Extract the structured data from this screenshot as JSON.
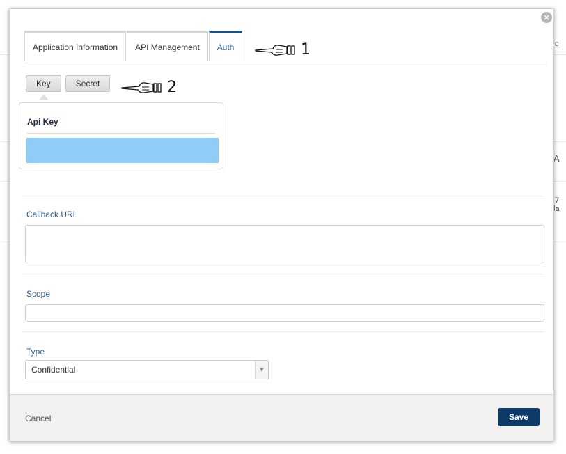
{
  "modal": {
    "close_icon": "close-icon",
    "tabs": [
      {
        "label": "Application Information",
        "active": false
      },
      {
        "label": "API Management",
        "active": false
      },
      {
        "label": "Auth",
        "active": true
      }
    ],
    "annotations": {
      "tab_pointer_number": "1",
      "toggle_pointer_number": "2"
    },
    "credential_toggle": {
      "key_label": "Key",
      "secret_label": "Secret"
    },
    "api_key_panel": {
      "title": "Api Key",
      "value": ""
    },
    "callback_url": {
      "label": "Callback URL",
      "value": ""
    },
    "scope": {
      "label": "Scope",
      "value": ""
    },
    "type": {
      "label": "Type",
      "selected": "Confidential"
    },
    "footer": {
      "cancel_label": "Cancel",
      "save_label": "Save"
    }
  },
  "background_fragments": [
    "c",
    "A",
    "7",
    "la"
  ],
  "colors": {
    "active_tab_border": "#1f4e79",
    "key_value_bg": "#8fcdf7",
    "save_button_bg": "#0d3a66",
    "footer_bg": "#f2f1ef"
  }
}
